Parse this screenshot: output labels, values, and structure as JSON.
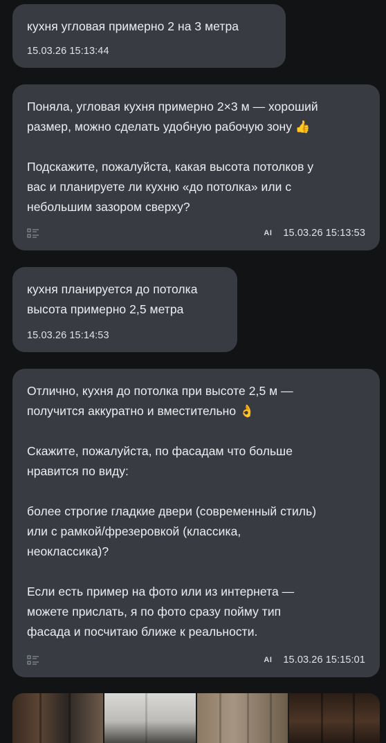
{
  "messages": [
    {
      "role": "user",
      "text": "кухня угловая примерно 2 на 3 метра",
      "time": "15.03.26 15:13:44"
    },
    {
      "role": "ai",
      "text": "Поняла, угловая кухня примерно 2×3 м — хороший\nразмер, можно сделать удобную рабочую зону 👍\n\nПодскажите, пожалуйста, какая высота потолков у\nвас и планируете ли кухню «до потолка» или с\nнебольшим зазором сверху?",
      "badge": "AI",
      "time": "15.03.26 15:13:53"
    },
    {
      "role": "user",
      "text": "кухня планируется до потолка\nвысота примерно 2,5 метра",
      "time": "15.03.26 15:14:53"
    },
    {
      "role": "ai",
      "text": "Отлично, кухня до потолка при высоте 2,5 м —\nполучится аккуратно и вместительно 👌\n\nСкажите, пожалуйста, по фасадам что больше\nнравится по виду:\n\nболее строгие гладкие двери (современный стиль)\nили с рамкой/фрезеровкой (классика,\nнеоклассика)?\n\nЕсли есть пример на фото или из интернета —\nможете прислать, я по фото сразу пойму тип\nфасада и посчитаю ближе к реальности.",
      "badge": "AI",
      "time": "15.03.26 15:15:01"
    }
  ],
  "icons": {
    "message_action": "list-icon"
  },
  "gallery": {
    "thumbnails": 4
  }
}
